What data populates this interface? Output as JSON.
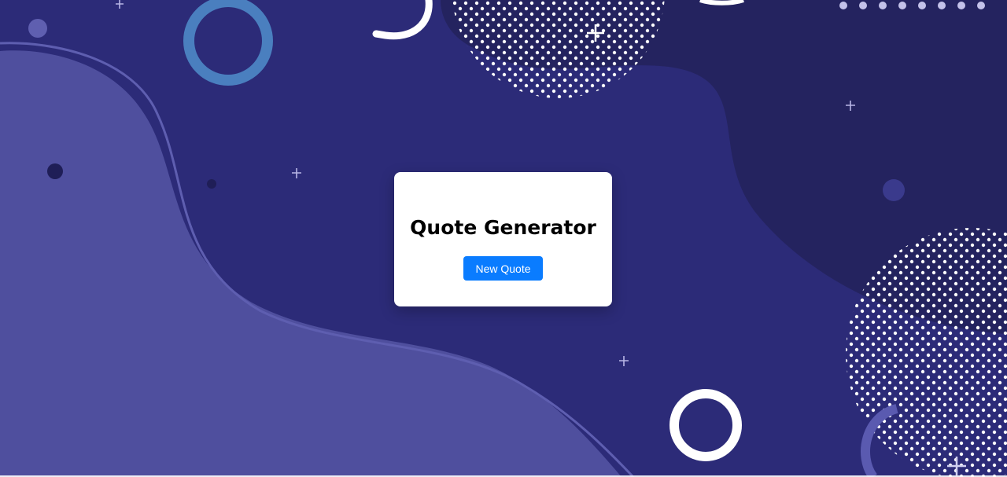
{
  "app": {
    "title": "Quote Generator",
    "new_quote_label": "New Quote"
  },
  "colors": {
    "background": "#2c2b78",
    "blob_left": "#4f4f9e",
    "blob_right_dark": "#24235f",
    "ring_blue": "#4a7fbf",
    "card": "#ffffff",
    "button": "#0a7cff"
  }
}
